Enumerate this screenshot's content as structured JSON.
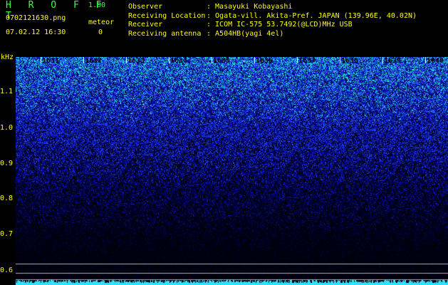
{
  "app": {
    "title": "H R O F F T",
    "version": "1.00"
  },
  "file": {
    "name": "0702121630.png",
    "datetime": "07.02.12 16:30"
  },
  "mode": {
    "label": "meteor",
    "count": "0"
  },
  "info": [
    {
      "label": "Observer",
      "value": ": Masayuki Kobayashi"
    },
    {
      "label": "Receiving Location",
      "value": ": Ogata-vill. Akita-Pref. JAPAN (139.96E, 40.02N)"
    },
    {
      "label": "Receiver",
      "value": ": ICOM IC-575 53.7492(@LCD)MHz USB"
    },
    {
      "label": "Receiving antenna",
      "value": ": A504HB(yagi 4el)"
    }
  ],
  "axis": {
    "unit": "kHz",
    "y_labels": [
      "1.1",
      "1.0",
      "0.9",
      "0.8",
      "0.7",
      "0.6"
    ],
    "time_ticks": [
      "1631",
      "1632",
      "1633",
      "1634",
      "1635",
      "1636",
      "1637",
      "1638",
      "1639",
      "1640"
    ]
  },
  "colors": {
    "label": "#ffff00",
    "title": "#3cff3c",
    "spectrum_dark": "#000030",
    "spectrum_mid": "#1030ff",
    "spectrum_hot": "#40ffd0"
  }
}
